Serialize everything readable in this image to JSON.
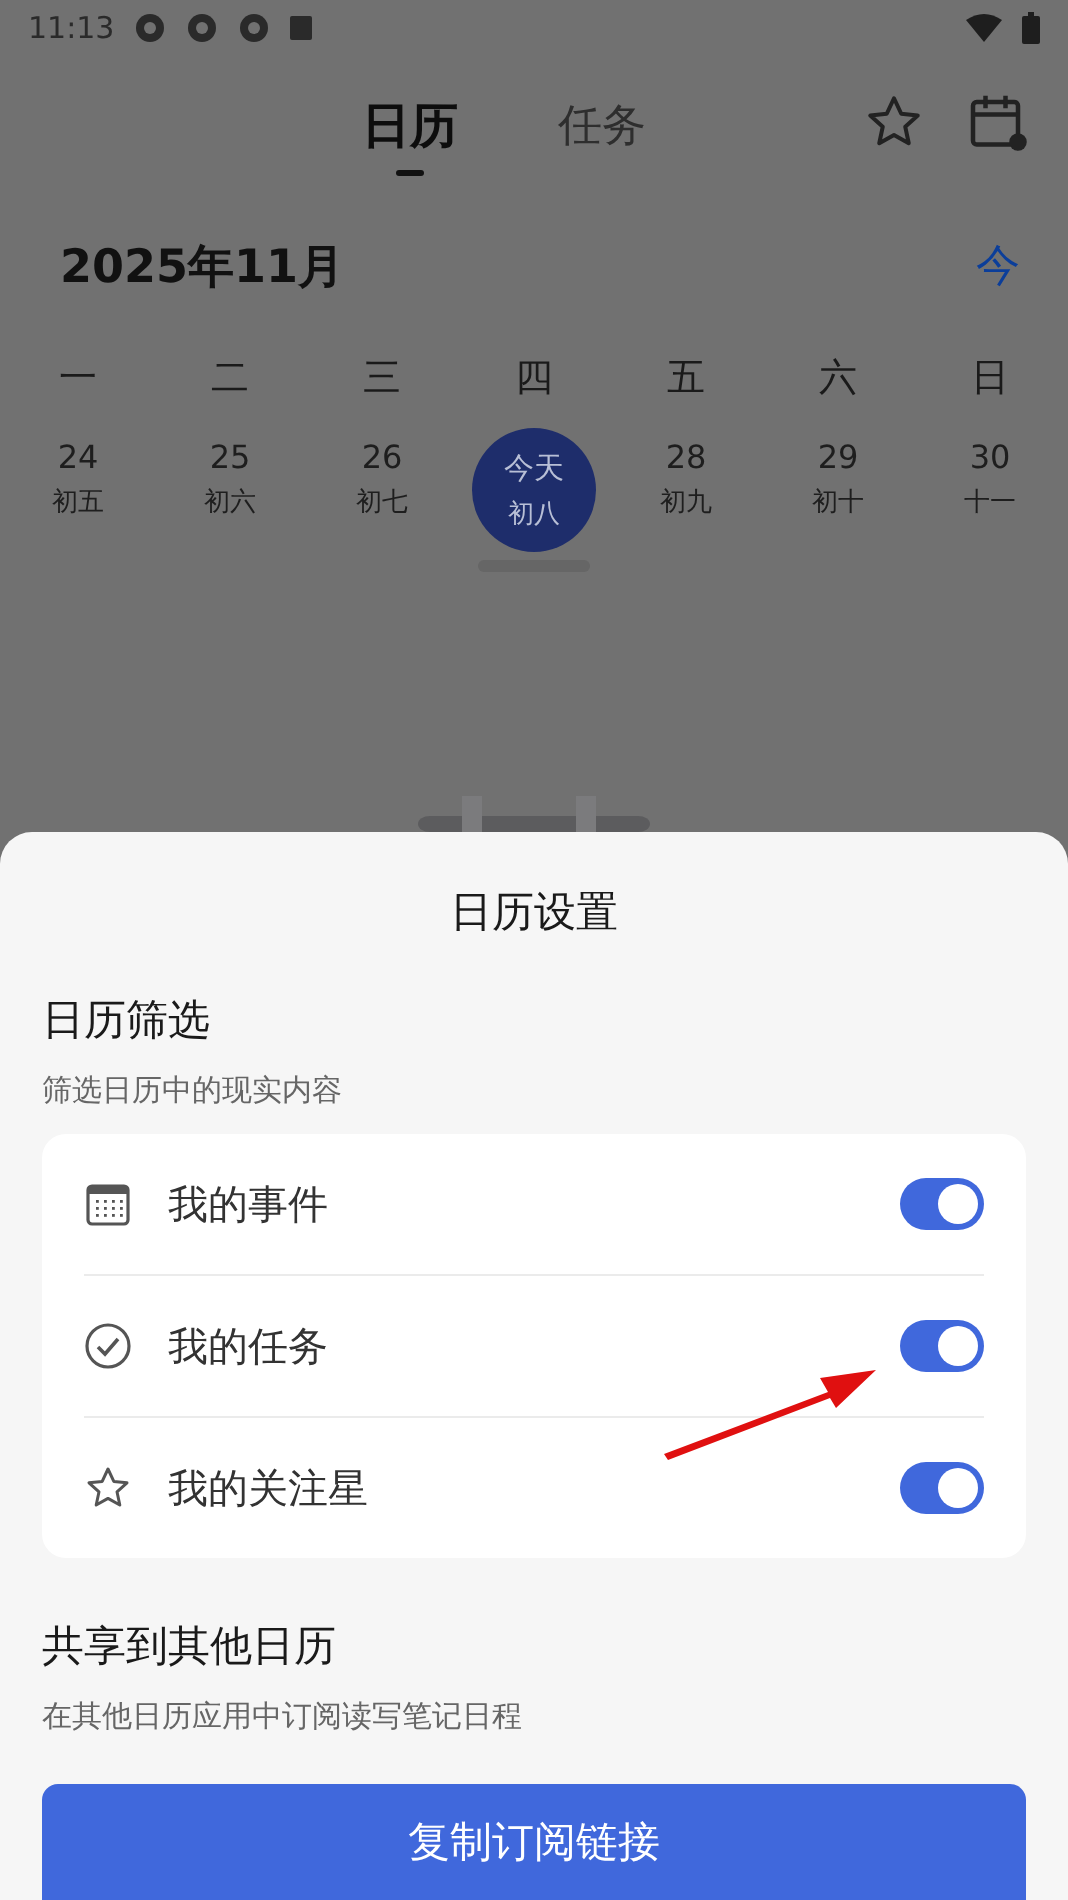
{
  "status_bar": {
    "time": "11:13"
  },
  "header": {
    "tabs": [
      {
        "label": "日历",
        "selected": true
      },
      {
        "label": "任务",
        "selected": false
      }
    ]
  },
  "month": {
    "title": "2025年11月",
    "today_button": "今"
  },
  "weekdays": [
    "一",
    "二",
    "三",
    "四",
    "五",
    "六",
    "日"
  ],
  "days": [
    {
      "date": "24",
      "lunar": "初五",
      "selected": false
    },
    {
      "date": "25",
      "lunar": "初六",
      "selected": false
    },
    {
      "date": "26",
      "lunar": "初七",
      "selected": false
    },
    {
      "date": "今天",
      "lunar": "初八",
      "selected": true
    },
    {
      "date": "28",
      "lunar": "初九",
      "selected": false
    },
    {
      "date": "29",
      "lunar": "初十",
      "selected": false
    },
    {
      "date": "30",
      "lunar": "十一",
      "selected": false
    }
  ],
  "sheet": {
    "title": "日历设置",
    "filter_section": {
      "title": "日历筛选",
      "subtitle": "筛选日历中的现实内容"
    },
    "filters": [
      {
        "kind": "calendar",
        "label": "我的事件",
        "on": true
      },
      {
        "kind": "check",
        "label": "我的任务",
        "on": true
      },
      {
        "kind": "star",
        "label": "我的关注星",
        "on": true
      }
    ],
    "share_section": {
      "title": "共享到其他日历",
      "subtitle": "在其他日历应用中订阅读写笔记日程"
    },
    "copy_button": "复制订阅链接"
  }
}
